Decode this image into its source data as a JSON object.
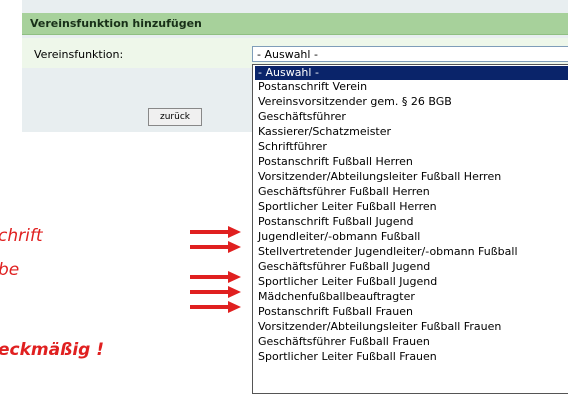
{
  "dialog": {
    "title": "Vereinsfunktion hinzufügen",
    "field_label": "Vereinsfunktion:",
    "select_value": "- Auswahl -",
    "back_button": "zurück"
  },
  "dropdown": {
    "options": [
      "- Auswahl -",
      "Postanschrift Verein",
      "Vereinsvorsitzender gem. § 26 BGB",
      "Geschäftsführer",
      "Kassierer/Schatzmeister",
      "Schriftführer",
      "Postanschrift Fußball Herren",
      "Vorsitzender/Abteilungsleiter Fußball Herren",
      "Geschäftsführer Fußball Herren",
      "Sportlicher Leiter Fußball Herren",
      "Postanschrift Fußball Jugend",
      "Jugendleiter/-obmann Fußball",
      "Stellvertretender Jugendleiter/-obmann Fußball",
      "Geschäftsführer Fußball Jugend",
      "Sportlicher Leiter Fußball Jugend",
      "Mädchenfußballbeauftragter",
      "Postanschrift Fußball Frauen",
      "Vorsitzender/Abteilungsleiter Fußball Frauen",
      "Geschäftsführer Fußball Frauen",
      "Sportlicher Leiter Fußball Frauen"
    ],
    "selected_index": 0
  },
  "annotations": {
    "line1": "chrift",
    "line2": "be",
    "line3": "eckmäßig !"
  },
  "colors": {
    "arrow": "#e02020",
    "header": "#a7d19b",
    "selection": "#0a246a"
  }
}
